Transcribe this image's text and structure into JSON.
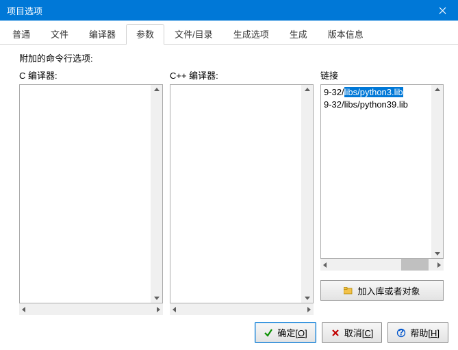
{
  "window": {
    "title": "项目选项"
  },
  "tabs": [
    "普通",
    "文件",
    "编译器",
    "参数",
    "文件/目录",
    "生成选项",
    "生成",
    "版本信息"
  ],
  "active_tab_index": 3,
  "section_label": "附加的命令行选项:",
  "columns": {
    "c_compiler": {
      "label": "C 编译器:"
    },
    "cpp_compiler": {
      "label": "C++ 编译器:"
    },
    "linker": {
      "label": "链接",
      "lines": [
        {
          "prefix": "9-32/",
          "selected": "libs/python3.lib"
        },
        {
          "text": "9-32/libs/python39.lib"
        }
      ]
    }
  },
  "add_button": "加入库或者对象",
  "buttons": {
    "ok": {
      "label": "确定[",
      "accel": "O",
      "tail": "]"
    },
    "cancel": {
      "label": "取消[",
      "accel": "C",
      "tail": "]"
    },
    "help": {
      "label": "帮助[",
      "accel": "H",
      "tail": "]"
    }
  }
}
